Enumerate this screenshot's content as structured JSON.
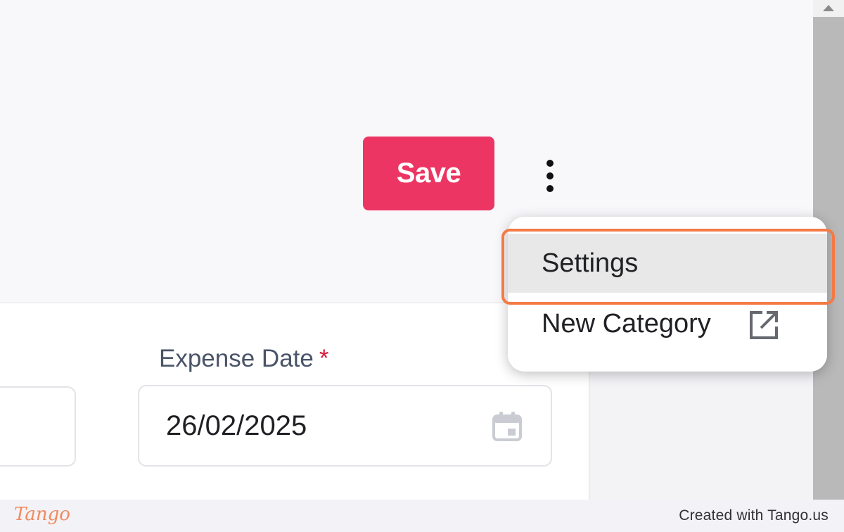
{
  "toolbar": {
    "save_label": "Save",
    "more_icon": "more-vertical-icon"
  },
  "menu": {
    "items": [
      {
        "label": "Settings",
        "highlighted": true
      },
      {
        "label": "New Category",
        "icon": "external-link-icon"
      }
    ]
  },
  "form": {
    "expense_date": {
      "label": "Expense Date",
      "required_marker": "*",
      "value": "26/02/2025",
      "icon": "calendar-icon"
    }
  },
  "footer": {
    "logo": "Tango",
    "credit": "Created with Tango.us"
  },
  "colors": {
    "accent": "#ec3563",
    "highlight": "#f47a45",
    "required": "#d21f3c"
  }
}
